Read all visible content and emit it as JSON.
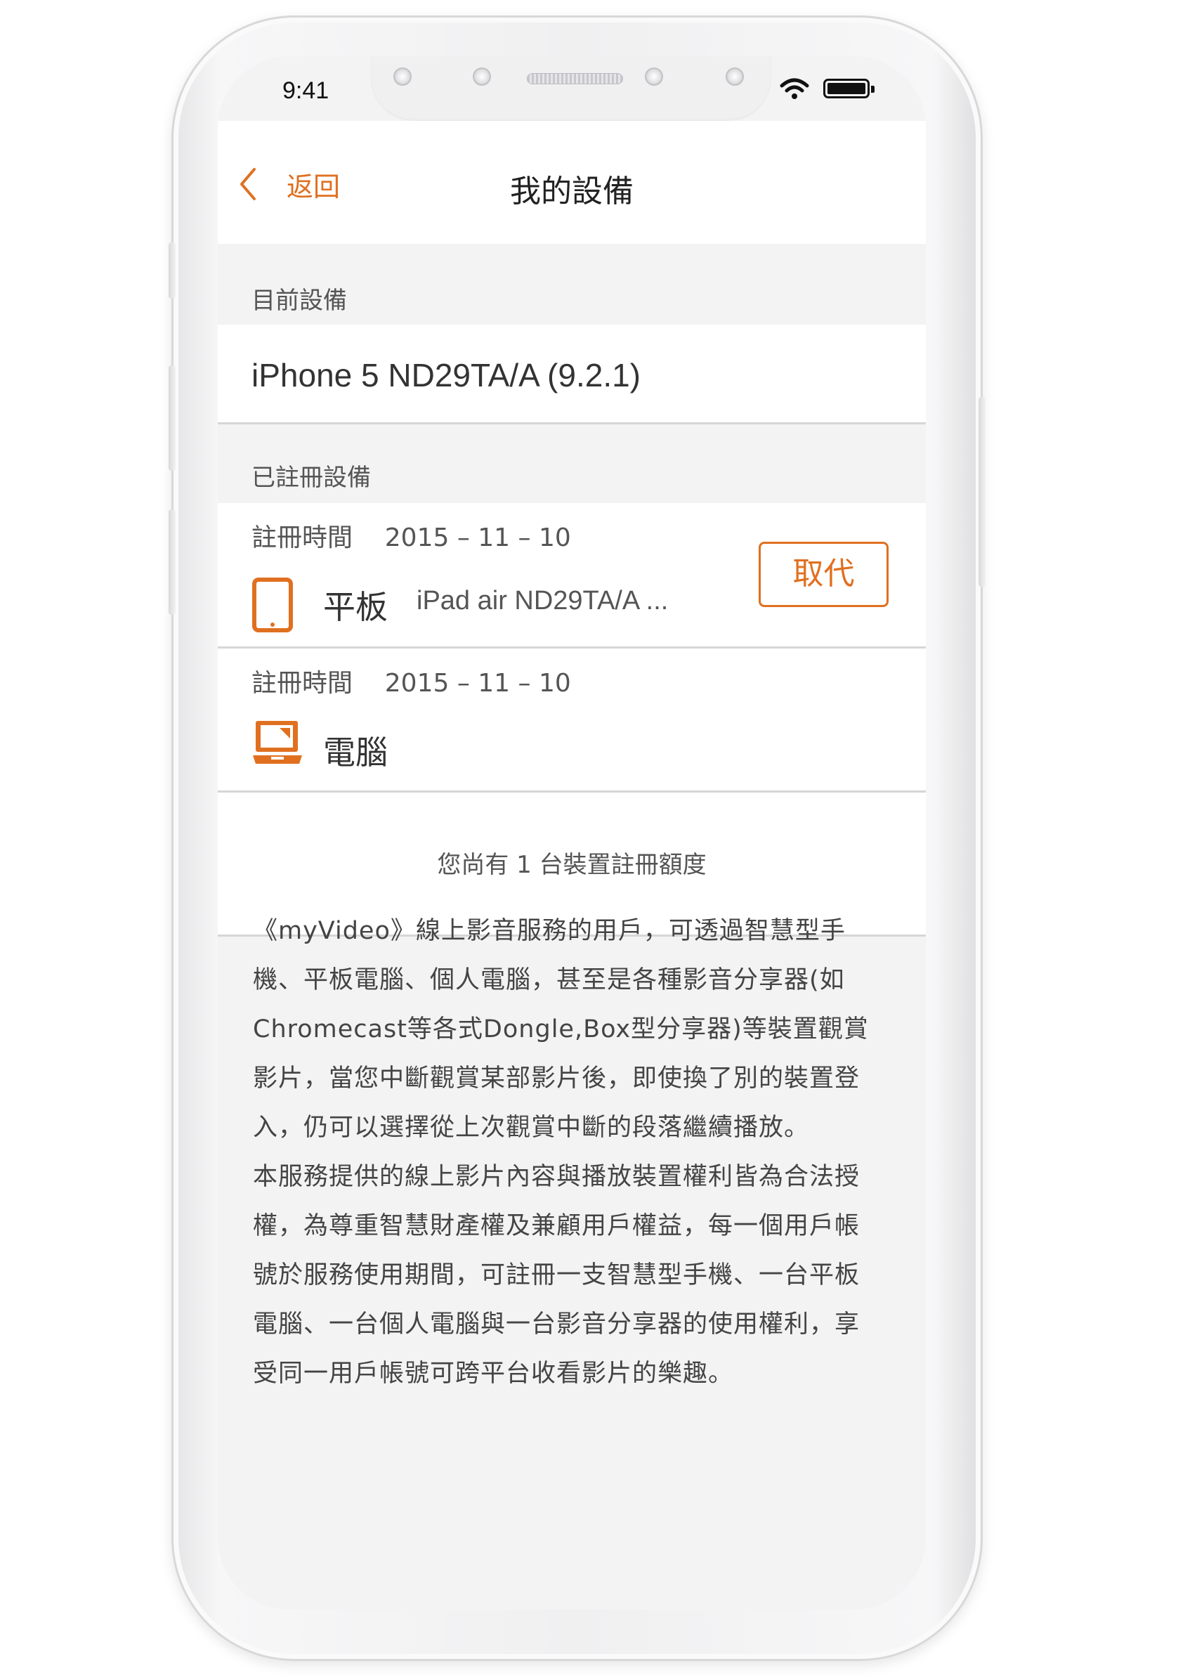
{
  "status_bar": {
    "time": "9:41",
    "icons": [
      "wifi-icon",
      "battery-icon"
    ]
  },
  "nav": {
    "back_label": "返回",
    "title": "我的設備",
    "back_icon": "chevron-left-icon"
  },
  "current_device": {
    "section_label": "目前設備",
    "name": "iPhone 5 ND29TA/A (9.2.1)"
  },
  "registered": {
    "section_label": "已註冊設備",
    "devices": [
      {
        "reg_time": "註冊時間    2015 – 11 – 10",
        "icon": "tablet-icon",
        "type": "平板",
        "name": "iPad air ND29TA/A ...",
        "action_label": "取代"
      },
      {
        "reg_time": "註冊時間    2015 – 11 – 10",
        "icon": "laptop-icon",
        "type": "電腦",
        "name": ""
      }
    ]
  },
  "quota_text": "您尚有 1 台裝置註冊額度",
  "description": {
    "lines": [
      "《myVideo》線上影音服務的用戶，可透過智慧型手",
      "機、平板電腦、個人電腦，甚至是各種影音分享器(如",
      "Chromecast等各式Dongle,Box型分享器)等裝置觀賞",
      "影片，當您中斷觀賞某部影片後，即使換了別的裝置登",
      "入，仍可以選擇從上次觀賞中斷的段落繼續播放。",
      "本服務提供的線上影片內容與播放裝置權利皆為合法授",
      "權，為尊重智慧財產權及兼顧用戶權益，每一個用戶帳",
      "號於服務使用期間，可註冊一支智慧型手機、一台平板",
      "電腦、一台個人電腦與一台影音分享器的使用權利，享",
      "受同一用戶帳號可跨平台收看影片的樂趣。"
    ]
  },
  "colors": {
    "accent": "#e07020",
    "background": "#f3f3f3",
    "row_background": "#ffffff"
  }
}
